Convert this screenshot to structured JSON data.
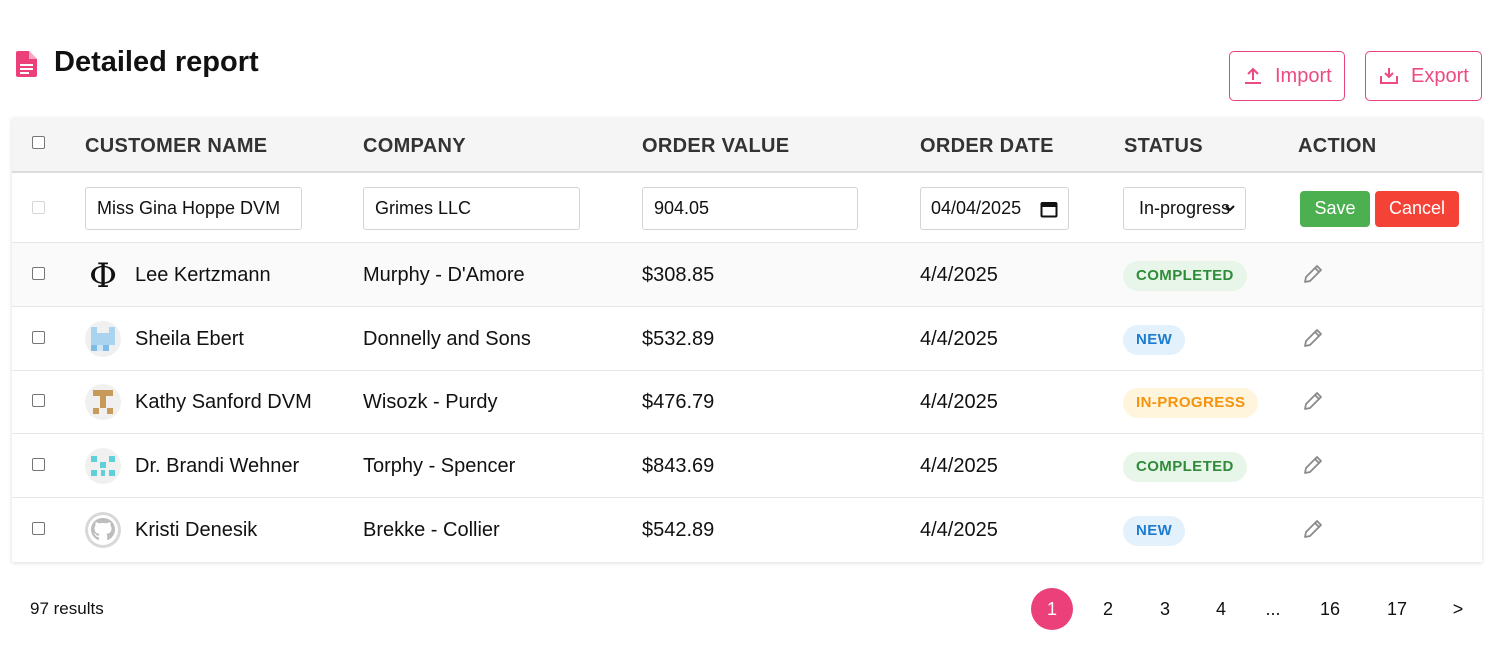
{
  "header": {
    "title": "Detailed report",
    "import_label": "Import",
    "export_label": "Export"
  },
  "table": {
    "columns": [
      "CUSTOMER NAME",
      "COMPANY",
      "ORDER VALUE",
      "ORDER DATE",
      "STATUS",
      "ACTION"
    ],
    "edit_row": {
      "customer_name": "Miss Gina Hoppe DVM",
      "company": "Grimes LLC",
      "order_value": "904.05",
      "order_date": "04/04/2025",
      "status": "In-progress",
      "save_label": "Save",
      "cancel_label": "Cancel"
    },
    "rows": [
      {
        "name": "Lee Kertzmann",
        "company": "Murphy - D'Amore",
        "value": "$308.85",
        "date": "4/4/2025",
        "status": "COMPLETED"
      },
      {
        "name": "Sheila Ebert",
        "company": "Donnelly and Sons",
        "value": "$532.89",
        "date": "4/4/2025",
        "status": "NEW"
      },
      {
        "name": "Kathy Sanford DVM",
        "company": "Wisozk - Purdy",
        "value": "$476.79",
        "date": "4/4/2025",
        "status": "IN-PROGRESS"
      },
      {
        "name": "Dr. Brandi Wehner",
        "company": "Torphy - Spencer",
        "value": "$843.69",
        "date": "4/4/2025",
        "status": "COMPLETED"
      },
      {
        "name": "Kristi Denesik",
        "company": "Brekke - Collier",
        "value": "$542.89",
        "date": "4/4/2025",
        "status": "NEW"
      }
    ]
  },
  "footer": {
    "results": "97 results",
    "pages": [
      "1",
      "2",
      "3",
      "4",
      "...",
      "16",
      "17",
      ">"
    ],
    "active_page": "1"
  },
  "colors": {
    "accent": "#ec407a",
    "save": "#4caf50",
    "cancel": "#f44336",
    "completed": "#2e8b3a",
    "new": "#1e7ccf",
    "in_progress": "#f5930c"
  }
}
